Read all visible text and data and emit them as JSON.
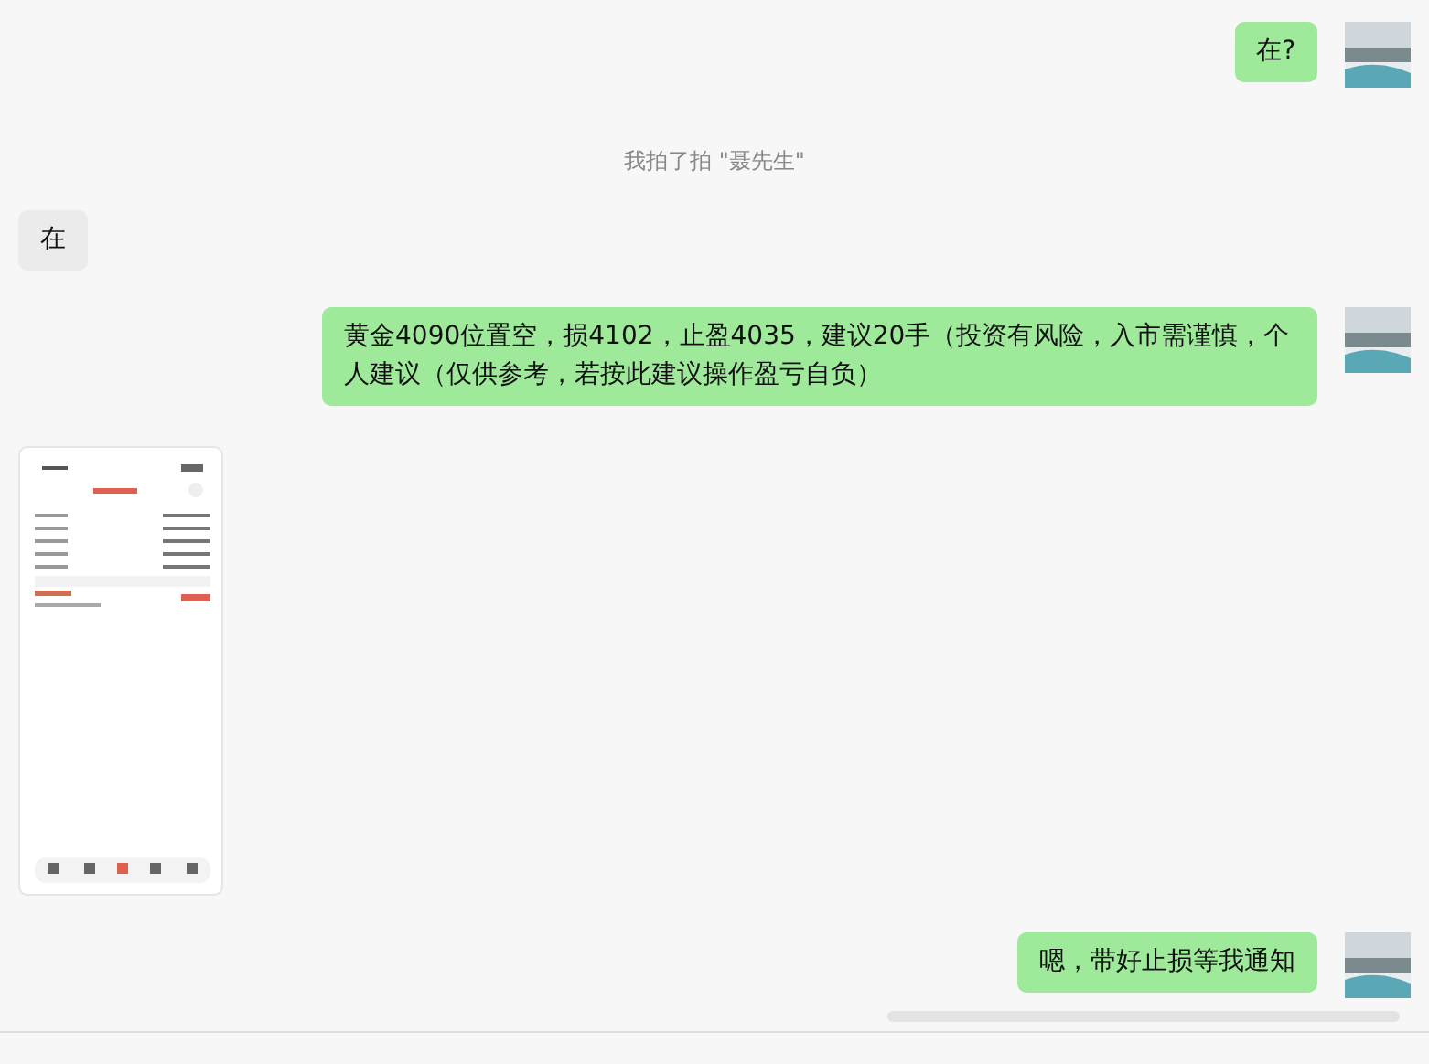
{
  "messages": [
    {
      "kind": "outgoing",
      "text": "在?"
    },
    {
      "kind": "system",
      "text": "我拍了拍 \"聂先生\""
    },
    {
      "kind": "incoming",
      "text": "在"
    },
    {
      "kind": "outgoing",
      "text": "黄金4090位置空，损4102，止盈4035，建议20手（投资有风险，入市需谨慎，个人建议（仅供参考，若按此建议操作盈亏自负）"
    },
    {
      "kind": "image"
    },
    {
      "kind": "outgoing",
      "text": "嗯，带好止损等我通知"
    }
  ]
}
